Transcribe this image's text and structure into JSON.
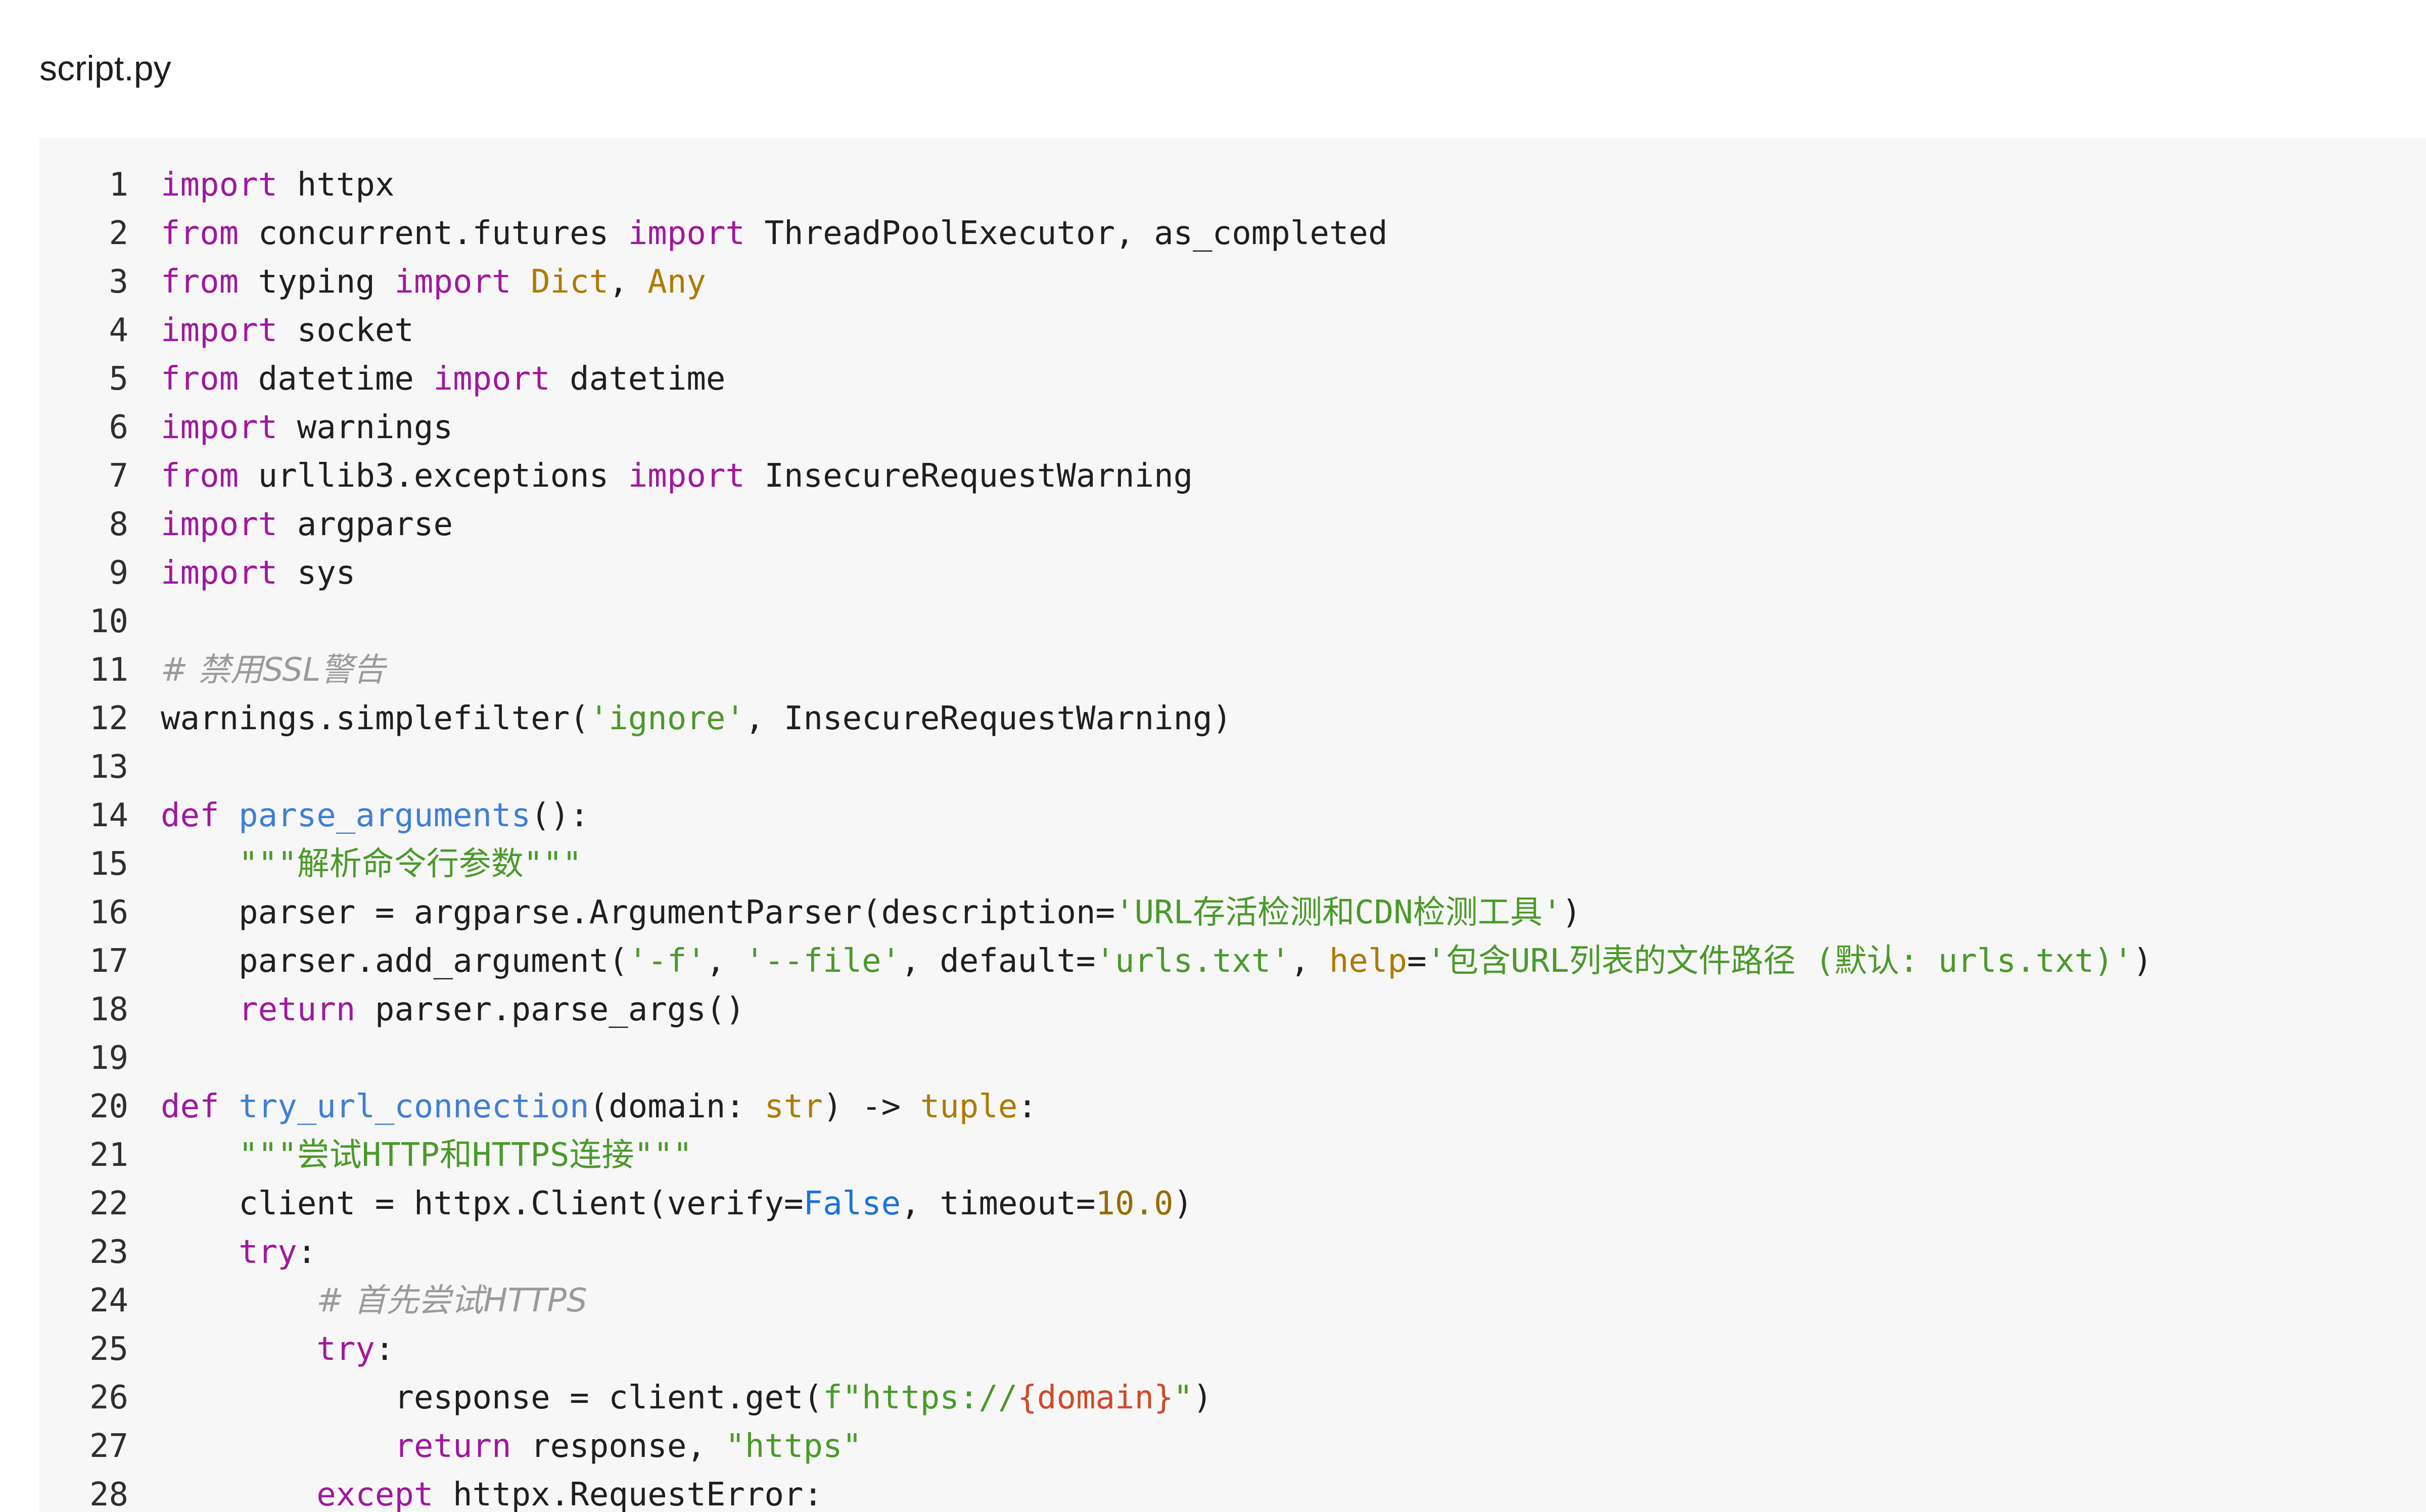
{
  "file_name": "script.py",
  "colors": {
    "background": "#ffffff",
    "code_background": "#f7f7f7",
    "keyword": "#a0189e",
    "function": "#3f7fd6",
    "string": "#4a9a2a",
    "comment": "#9a9a9a",
    "number": "#9b6a00",
    "type": "#b07a00",
    "builtin": "#1a73d9",
    "interpolation": "#d04a2a"
  },
  "lines": [
    {
      "n": "1",
      "tokens": [
        [
          "kw",
          "import"
        ],
        [
          "plain",
          " httpx"
        ]
      ]
    },
    {
      "n": "2",
      "tokens": [
        [
          "kw",
          "from"
        ],
        [
          "plain",
          " concurrent.futures "
        ],
        [
          "kw",
          "import"
        ],
        [
          "plain",
          " ThreadPoolExecutor, as_completed"
        ]
      ]
    },
    {
      "n": "3",
      "tokens": [
        [
          "kw",
          "from"
        ],
        [
          "plain",
          " typing "
        ],
        [
          "kw",
          "import"
        ],
        [
          "plain",
          " "
        ],
        [
          "type",
          "Dict"
        ],
        [
          "plain",
          ", "
        ],
        [
          "type",
          "Any"
        ]
      ]
    },
    {
      "n": "4",
      "tokens": [
        [
          "kw",
          "import"
        ],
        [
          "plain",
          " socket"
        ]
      ]
    },
    {
      "n": "5",
      "tokens": [
        [
          "kw",
          "from"
        ],
        [
          "plain",
          " datetime "
        ],
        [
          "kw",
          "import"
        ],
        [
          "plain",
          " datetime"
        ]
      ]
    },
    {
      "n": "6",
      "tokens": [
        [
          "kw",
          "import"
        ],
        [
          "plain",
          " warnings"
        ]
      ]
    },
    {
      "n": "7",
      "tokens": [
        [
          "kw",
          "from"
        ],
        [
          "plain",
          " urllib3.exceptions "
        ],
        [
          "kw",
          "import"
        ],
        [
          "plain",
          " InsecureRequestWarning"
        ]
      ]
    },
    {
      "n": "8",
      "tokens": [
        [
          "kw",
          "import"
        ],
        [
          "plain",
          " argparse"
        ]
      ]
    },
    {
      "n": "9",
      "tokens": [
        [
          "kw",
          "import"
        ],
        [
          "plain",
          " sys"
        ]
      ]
    },
    {
      "n": "10",
      "tokens": []
    },
    {
      "n": "11",
      "tokens": [
        [
          "cmt",
          "# 禁用SSL警告"
        ]
      ]
    },
    {
      "n": "12",
      "tokens": [
        [
          "plain",
          "warnings.simplefilter("
        ],
        [
          "str",
          "'ignore'"
        ],
        [
          "plain",
          ", InsecureRequestWarning)"
        ]
      ]
    },
    {
      "n": "13",
      "tokens": []
    },
    {
      "n": "14",
      "tokens": [
        [
          "kw",
          "def"
        ],
        [
          "plain",
          " "
        ],
        [
          "fn",
          "parse_arguments"
        ],
        [
          "plain",
          "():"
        ]
      ]
    },
    {
      "n": "15",
      "tokens": [
        [
          "plain",
          "    "
        ],
        [
          "doc",
          "\"\"\"解析命令行参数\"\"\""
        ]
      ]
    },
    {
      "n": "16",
      "tokens": [
        [
          "plain",
          "    parser = argparse.ArgumentParser(description="
        ],
        [
          "str",
          "'URL存活检测和CDN检测工具'"
        ],
        [
          "plain",
          ")"
        ]
      ]
    },
    {
      "n": "17",
      "tokens": [
        [
          "plain",
          "    parser.add_argument("
        ],
        [
          "str",
          "'-f'"
        ],
        [
          "plain",
          ", "
        ],
        [
          "str",
          "'--file'"
        ],
        [
          "plain",
          ", default="
        ],
        [
          "str",
          "'urls.txt'"
        ],
        [
          "plain",
          ", "
        ],
        [
          "type",
          "help"
        ],
        [
          "plain",
          "="
        ],
        [
          "str",
          "'包含URL列表的文件路径 (默认: urls.txt)'"
        ],
        [
          "plain",
          ")"
        ]
      ]
    },
    {
      "n": "18",
      "tokens": [
        [
          "plain",
          "    "
        ],
        [
          "kw",
          "return"
        ],
        [
          "plain",
          " parser.parse_args()"
        ]
      ]
    },
    {
      "n": "19",
      "tokens": []
    },
    {
      "n": "20",
      "tokens": [
        [
          "kw",
          "def"
        ],
        [
          "plain",
          " "
        ],
        [
          "fn",
          "try_url_connection"
        ],
        [
          "plain",
          "(domain: "
        ],
        [
          "type",
          "str"
        ],
        [
          "plain",
          ") -> "
        ],
        [
          "type",
          "tuple"
        ],
        [
          "plain",
          ":"
        ]
      ]
    },
    {
      "n": "21",
      "tokens": [
        [
          "plain",
          "    "
        ],
        [
          "doc",
          "\"\"\"尝试HTTP和HTTPS连接\"\"\""
        ]
      ]
    },
    {
      "n": "22",
      "tokens": [
        [
          "plain",
          "    client = httpx.Client(verify="
        ],
        [
          "builtin",
          "False"
        ],
        [
          "plain",
          ", timeout="
        ],
        [
          "num",
          "10.0"
        ],
        [
          "plain",
          ")"
        ]
      ]
    },
    {
      "n": "23",
      "tokens": [
        [
          "plain",
          "    "
        ],
        [
          "kw",
          "try"
        ],
        [
          "plain",
          ":"
        ]
      ]
    },
    {
      "n": "24",
      "tokens": [
        [
          "plain",
          "        "
        ],
        [
          "cmt",
          "# 首先尝试HTTPS"
        ]
      ]
    },
    {
      "n": "25",
      "tokens": [
        [
          "plain",
          "        "
        ],
        [
          "kw",
          "try"
        ],
        [
          "plain",
          ":"
        ]
      ]
    },
    {
      "n": "26",
      "tokens": [
        [
          "plain",
          "            response = client.get("
        ],
        [
          "str",
          "f\"https://"
        ],
        [
          "interp",
          "{domain}"
        ],
        [
          "str",
          "\""
        ],
        [
          "plain",
          ")"
        ]
      ]
    },
    {
      "n": "27",
      "tokens": [
        [
          "plain",
          "            "
        ],
        [
          "kw",
          "return"
        ],
        [
          "plain",
          " response, "
        ],
        [
          "str",
          "\"https\""
        ]
      ]
    },
    {
      "n": "28",
      "tokens": [
        [
          "plain",
          "        "
        ],
        [
          "kw",
          "except"
        ],
        [
          "plain",
          " httpx.RequestError:"
        ]
      ]
    }
  ]
}
